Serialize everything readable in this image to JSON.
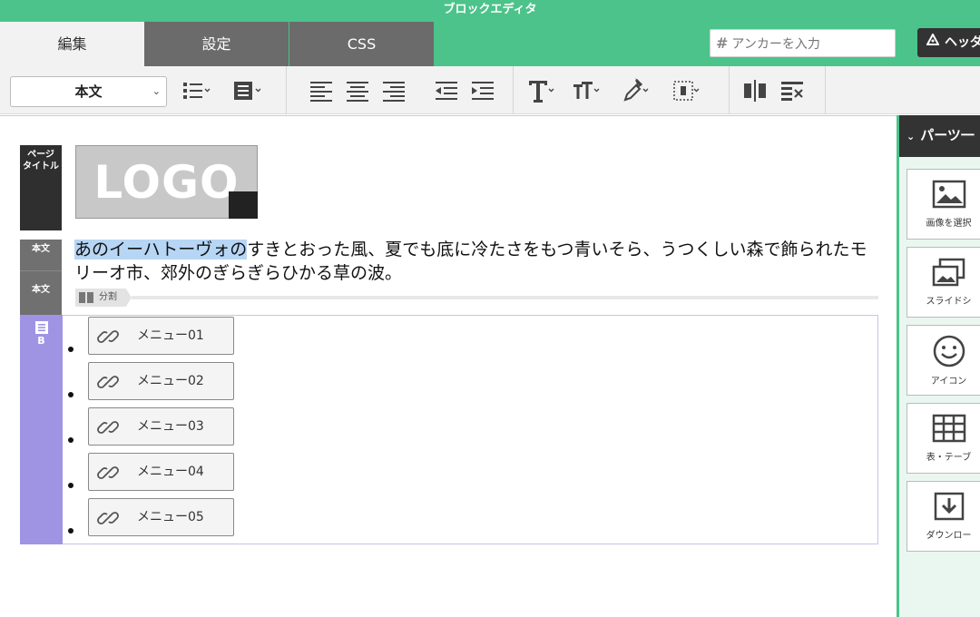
{
  "app": {
    "title": "ブロックエディタ"
  },
  "tabs": [
    {
      "label": "編集",
      "active": true
    },
    {
      "label": "設定",
      "active": false
    },
    {
      "label": "CSS",
      "active": false
    }
  ],
  "anchor": {
    "placeholder": "アンカーを入力"
  },
  "header_button": {
    "label": "ヘッダ"
  },
  "toolbar": {
    "block_type": "本文",
    "icons": [
      "unordered-list-icon",
      "block-style-icon",
      "align-left-icon",
      "align-center-icon",
      "align-right-icon",
      "outdent-icon",
      "indent-icon",
      "text-style-icon",
      "font-size-icon",
      "eyedropper-icon",
      "border-select-icon",
      "insert-column-icon",
      "clear-format-icon"
    ]
  },
  "canvas": {
    "page_title_label": "ページ\nタイトル",
    "logo_text": "LOGO",
    "body_label_1": "本文",
    "body_label_2": "本文",
    "paragraph_highlight": "あのイーハトーヴォの",
    "paragraph_rest": "すきとおった風、夏でも底に冷たさをもつ青いそら、うつくしい森で飾られたモリーオ市、郊外のぎらぎらひかる草の波。",
    "split_label": "分割",
    "list_label": "B",
    "menu_items": [
      "メニュー01",
      "メニュー02",
      "メニュー03",
      "メニュー04",
      "メニュー05"
    ]
  },
  "parts_panel": {
    "title": "パーツ一",
    "items": [
      {
        "label": "画像を選択",
        "icon": "image-icon"
      },
      {
        "label": "スライドシ",
        "icon": "slideshow-icon"
      },
      {
        "label": "アイコン",
        "icon": "smiley-icon"
      },
      {
        "label": "表・テーブ",
        "icon": "table-icon"
      },
      {
        "label": "ダウンロー",
        "icon": "download-icon"
      }
    ]
  },
  "colors": {
    "accent": "#4cc38a",
    "list_accent": "#9e94e3",
    "highlight": "#b7d6f5"
  }
}
